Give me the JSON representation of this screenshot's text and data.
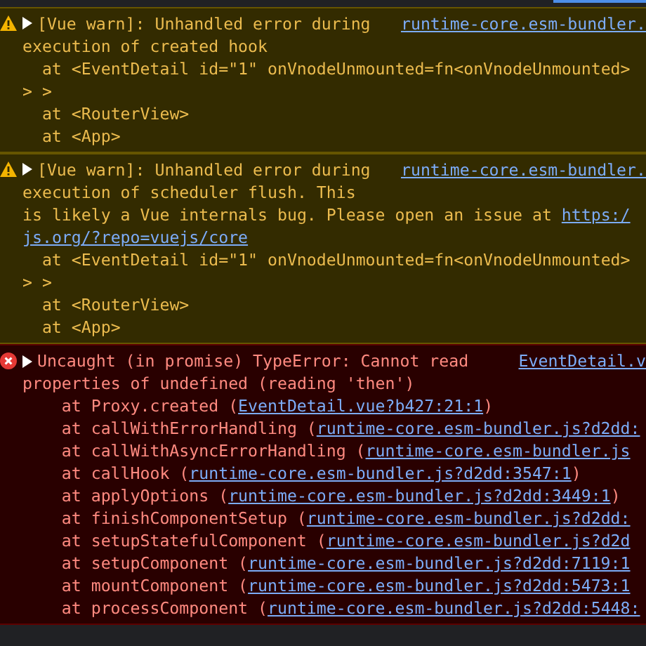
{
  "messages": [
    {
      "kind": "warning",
      "expanded": false,
      "source": "runtime-core.esm-bundler.",
      "lines": [
        {
          "kind": "message",
          "parts": [
            {
              "text": "[Vue warn]: Unhandled error during"
            }
          ]
        },
        {
          "kind": "message",
          "parts": [
            {
              "text": "execution of created hook"
            }
          ]
        },
        {
          "kind": "trace",
          "parts": [
            {
              "text": "at <EventDetail id=\"1\" onVnodeUnmounted=fn<onVnodeUnmounted>"
            }
          ]
        },
        {
          "kind": "message",
          "parts": [
            {
              "text": "> >"
            }
          ]
        },
        {
          "kind": "trace",
          "parts": [
            {
              "text": "at <RouterView>"
            }
          ]
        },
        {
          "kind": "trace",
          "parts": [
            {
              "text": "at <App>"
            }
          ]
        }
      ]
    },
    {
      "kind": "warning",
      "expanded": false,
      "source": "runtime-core.esm-bundler.",
      "lines": [
        {
          "kind": "message",
          "parts": [
            {
              "text": "[Vue warn]: Unhandled error during"
            }
          ]
        },
        {
          "kind": "message",
          "parts": [
            {
              "text": "execution of scheduler flush. This"
            }
          ]
        },
        {
          "kind": "message",
          "parts": [
            {
              "text": "is likely a Vue internals bug. Please open an issue at "
            },
            {
              "text": "https:/",
              "link": true
            }
          ]
        },
        {
          "kind": "message",
          "parts": [
            {
              "text": "js.org/?repo=vuejs/core",
              "link": true
            }
          ]
        },
        {
          "kind": "trace",
          "parts": [
            {
              "text": "at <EventDetail id=\"1\" onVnodeUnmounted=fn<onVnodeUnmounted>"
            }
          ]
        },
        {
          "kind": "message",
          "parts": [
            {
              "text": "> >"
            }
          ]
        },
        {
          "kind": "trace",
          "parts": [
            {
              "text": "at <RouterView>"
            }
          ]
        },
        {
          "kind": "trace",
          "parts": [
            {
              "text": "at <App>"
            }
          ]
        }
      ]
    },
    {
      "kind": "error",
      "expanded": false,
      "source": "EventDetail.v",
      "lines": [
        {
          "kind": "message",
          "parts": [
            {
              "text": "Uncaught (in promise) TypeError: Cannot read"
            }
          ]
        },
        {
          "kind": "message",
          "parts": [
            {
              "text": "properties of undefined (reading 'then')"
            }
          ]
        },
        {
          "kind": "stack",
          "parts": [
            {
              "text": "at Proxy.created ("
            },
            {
              "text": "EventDetail.vue?b427:21:1",
              "link": true
            },
            {
              "text": ")"
            }
          ]
        },
        {
          "kind": "stack",
          "parts": [
            {
              "text": "at callWithErrorHandling ("
            },
            {
              "text": "runtime-core.esm-bundler.js?d2dd:",
              "link": true
            }
          ]
        },
        {
          "kind": "stack",
          "parts": [
            {
              "text": "at callWithAsyncErrorHandling ("
            },
            {
              "text": "runtime-core.esm-bundler.js",
              "link": true
            }
          ]
        },
        {
          "kind": "stack",
          "parts": [
            {
              "text": "at callHook ("
            },
            {
              "text": "runtime-core.esm-bundler.js?d2dd:3547:1",
              "link": true
            },
            {
              "text": ")"
            }
          ]
        },
        {
          "kind": "stack",
          "parts": [
            {
              "text": "at applyOptions ("
            },
            {
              "text": "runtime-core.esm-bundler.js?d2dd:3449:1",
              "link": true
            },
            {
              "text": ")"
            }
          ]
        },
        {
          "kind": "stack",
          "parts": [
            {
              "text": "at finishComponentSetup ("
            },
            {
              "text": "runtime-core.esm-bundler.js?d2dd:",
              "link": true
            }
          ]
        },
        {
          "kind": "stack",
          "parts": [
            {
              "text": "at setupStatefulComponent ("
            },
            {
              "text": "runtime-core.esm-bundler.js?d2d",
              "link": true
            }
          ]
        },
        {
          "kind": "stack",
          "parts": [
            {
              "text": "at setupComponent ("
            },
            {
              "text": "runtime-core.esm-bundler.js?d2dd:7119:1",
              "link": true
            }
          ]
        },
        {
          "kind": "stack",
          "parts": [
            {
              "text": "at mountComponent ("
            },
            {
              "text": "runtime-core.esm-bundler.js?d2dd:5473:1",
              "link": true
            }
          ]
        },
        {
          "kind": "stack",
          "parts": [
            {
              "text": "at processComponent ("
            },
            {
              "text": "runtime-core.esm-bundler.js?d2dd:5448:",
              "link": true
            }
          ]
        }
      ]
    }
  ]
}
